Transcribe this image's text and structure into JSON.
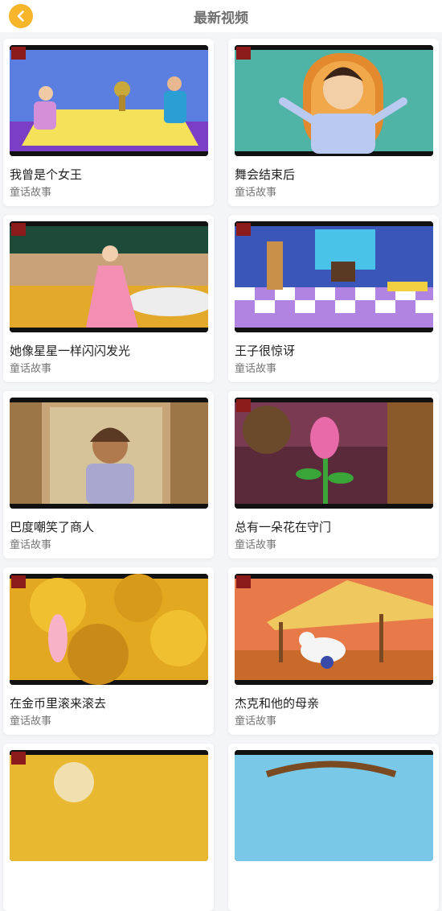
{
  "header": {
    "title": "最新视频"
  },
  "icons": {
    "back": "chevron-left-icon"
  },
  "colors": {
    "accent": "#f7b52c",
    "background": "#f4f5f7"
  },
  "videos": [
    {
      "title": "我曾是个女王",
      "category": "童话故事"
    },
    {
      "title": "舞会结束后",
      "category": "童话故事"
    },
    {
      "title": "她像星星一样闪闪发光",
      "category": "童话故事"
    },
    {
      "title": "王子很惊讶",
      "category": "童话故事"
    },
    {
      "title": "巴度嘲笑了商人",
      "category": "童话故事"
    },
    {
      "title": "总有一朵花在守门",
      "category": "童话故事"
    },
    {
      "title": "在金币里滚来滚去",
      "category": "童话故事"
    },
    {
      "title": "杰克和他的母亲",
      "category": "童话故事"
    },
    {
      "title": "",
      "category": ""
    },
    {
      "title": "",
      "category": ""
    }
  ]
}
